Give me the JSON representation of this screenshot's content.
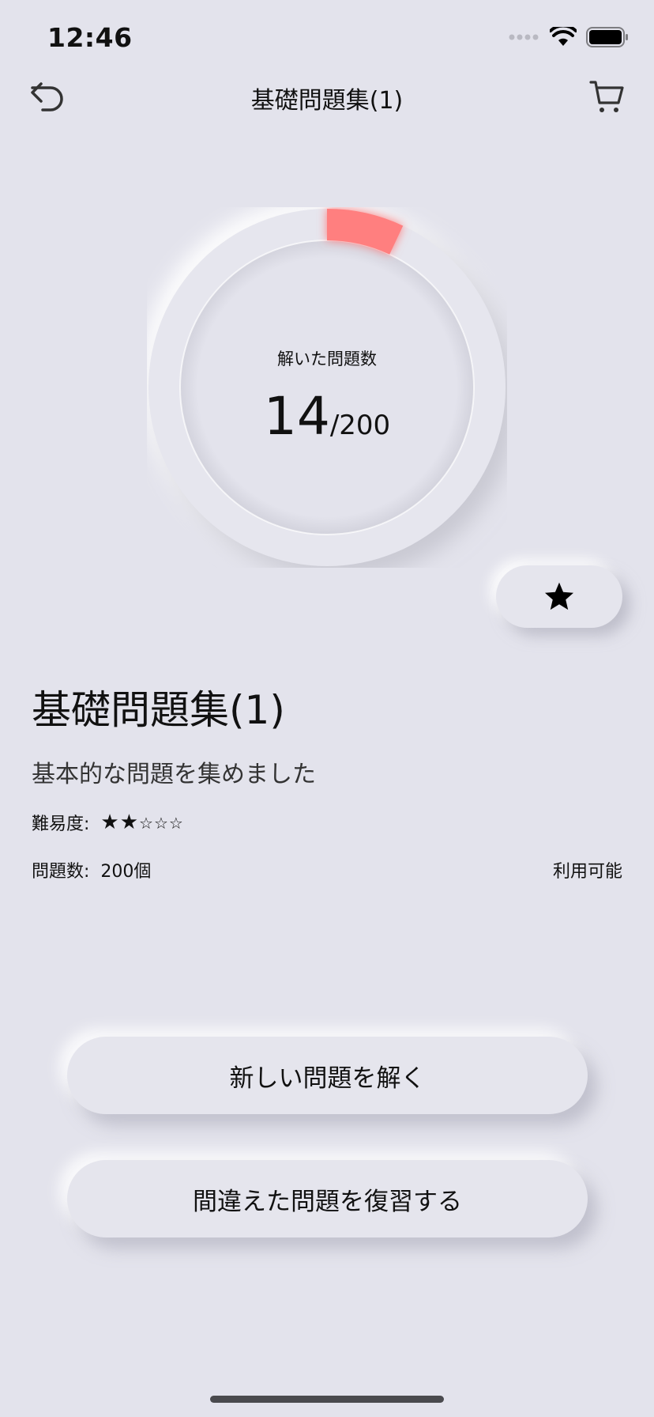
{
  "status_bar": {
    "time": "12:46"
  },
  "nav": {
    "title": "基礎問題集(1)",
    "back_icon": "undo-arrow-icon",
    "cart_icon": "cart-icon"
  },
  "progress": {
    "label": "解いた問題数",
    "solved": "14",
    "total": "/200",
    "fraction": 0.07,
    "accent_color": "#ff7f7f"
  },
  "favorite": {
    "icon": "star-icon"
  },
  "book": {
    "title": "基礎問題集(1)",
    "description": "基本的な問題を集めました",
    "difficulty_label": "難易度:",
    "difficulty_filled": "★★",
    "difficulty_empty": "☆☆☆",
    "difficulty_value": 2,
    "difficulty_max": 5,
    "count_label": "問題数:",
    "count_value": "200個",
    "availability": "利用可能"
  },
  "actions": {
    "new_label": "新しい問題を解く",
    "review_label": "間違えた問題を復習する"
  }
}
